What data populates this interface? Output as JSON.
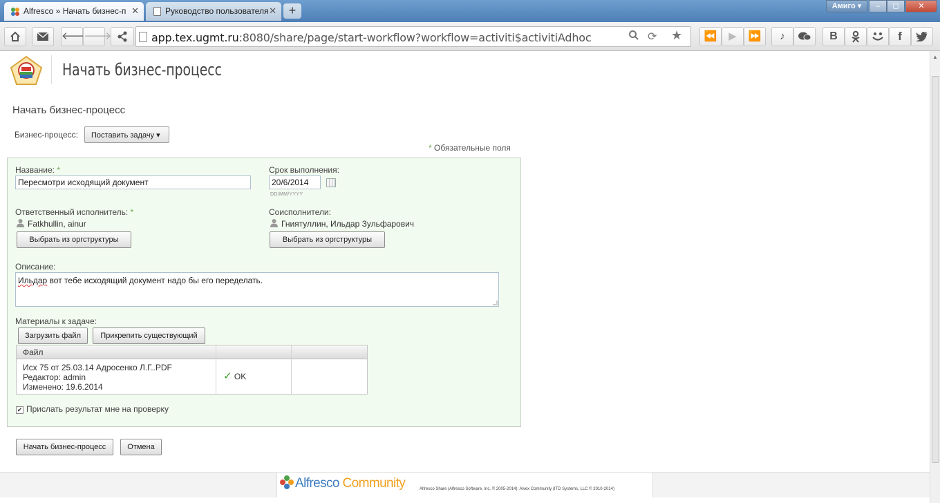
{
  "browser": {
    "tabs": [
      {
        "label": "Alfresco » Начать бизнес-п",
        "active": true
      },
      {
        "label": "Руководство пользователя",
        "active": false
      }
    ],
    "new_tab": "+",
    "profile": "Амиго",
    "window_controls": {
      "minimize": "–",
      "maximize": "◻",
      "close": "✕"
    },
    "url_host": "app.tex.ugmt.ru",
    "url_rest": ":8080/share/page/start-workflow?workflow=activiti$activitiAdhoc",
    "nav_icons": [
      "home-icon",
      "mail-icon",
      "back-icon",
      "forward-icon",
      "share-icon"
    ],
    "url_icons": [
      "search-icon",
      "reload-icon",
      "bookmark-star-icon"
    ],
    "media_icons": [
      "rewind-icon",
      "play-icon",
      "fast-forward-icon"
    ],
    "social_icons": [
      "music-icon",
      "chat-icon",
      "vk-icon",
      "odnoklassniki-icon",
      "moi-mir-icon",
      "facebook-icon",
      "twitter-icon"
    ]
  },
  "header": {
    "title": "Начать бизнес-процесс"
  },
  "page": {
    "section_title": "Начать бизнес-процесс",
    "workflow_label": "Бизнес-процесс:",
    "workflow_value": "Поставить задачу ▾",
    "required_star": "*",
    "required_note": "Обязательные поля"
  },
  "form": {
    "name_label": "Название:",
    "name_value": "Пересмотри исходящий документ",
    "due_label": "Срок выполнения:",
    "due_value": "20/6/2014",
    "due_hint": "DD/MM/YYYY",
    "assignee_label": "Ответственный исполнитель:",
    "assignee_name": "Fatkhullin, ainur",
    "coassignee_label": "Соисполнители:",
    "coassignee_name": "Гниятуллин, Ильдар Зульфарович",
    "select_button": "Выбрать из оргструктуры",
    "description_label": "Описание:",
    "description_first_word": "Ильдар",
    "description_rest": " вот тебе исходящий документ надо бы его переделать.",
    "items_label": "Материалы к задаче:",
    "upload_button": "Загрузить файл",
    "attach_button": "Прикрепить существующий",
    "files_header": "Файл",
    "files": [
      {
        "name": "Исх 75 от 25.03.14 Адросенко Л.Г..PDF",
        "editor": "Редактор: admin",
        "modified": "Изменено: 19.6.2014",
        "status": "OK"
      }
    ],
    "send_result_checked": true,
    "send_result_label": "Прислать результат мне на проверку"
  },
  "actions": {
    "start": "Начать бизнес-процесс",
    "cancel": "Отмена"
  },
  "footer": {
    "brand_alfresco": "Alfresco",
    "brand_community": "Community",
    "copyright": "Alfresco Share (Alfresco Software, Inc. © 2005-2014); Alvex Community (ITD Systems, LLC © 2010-2014)"
  },
  "colors": {
    "accent": "#3d7bbf",
    "form_bg": "#f2fbef",
    "required": "#6aa84f",
    "ok": "#3b9a2a"
  }
}
